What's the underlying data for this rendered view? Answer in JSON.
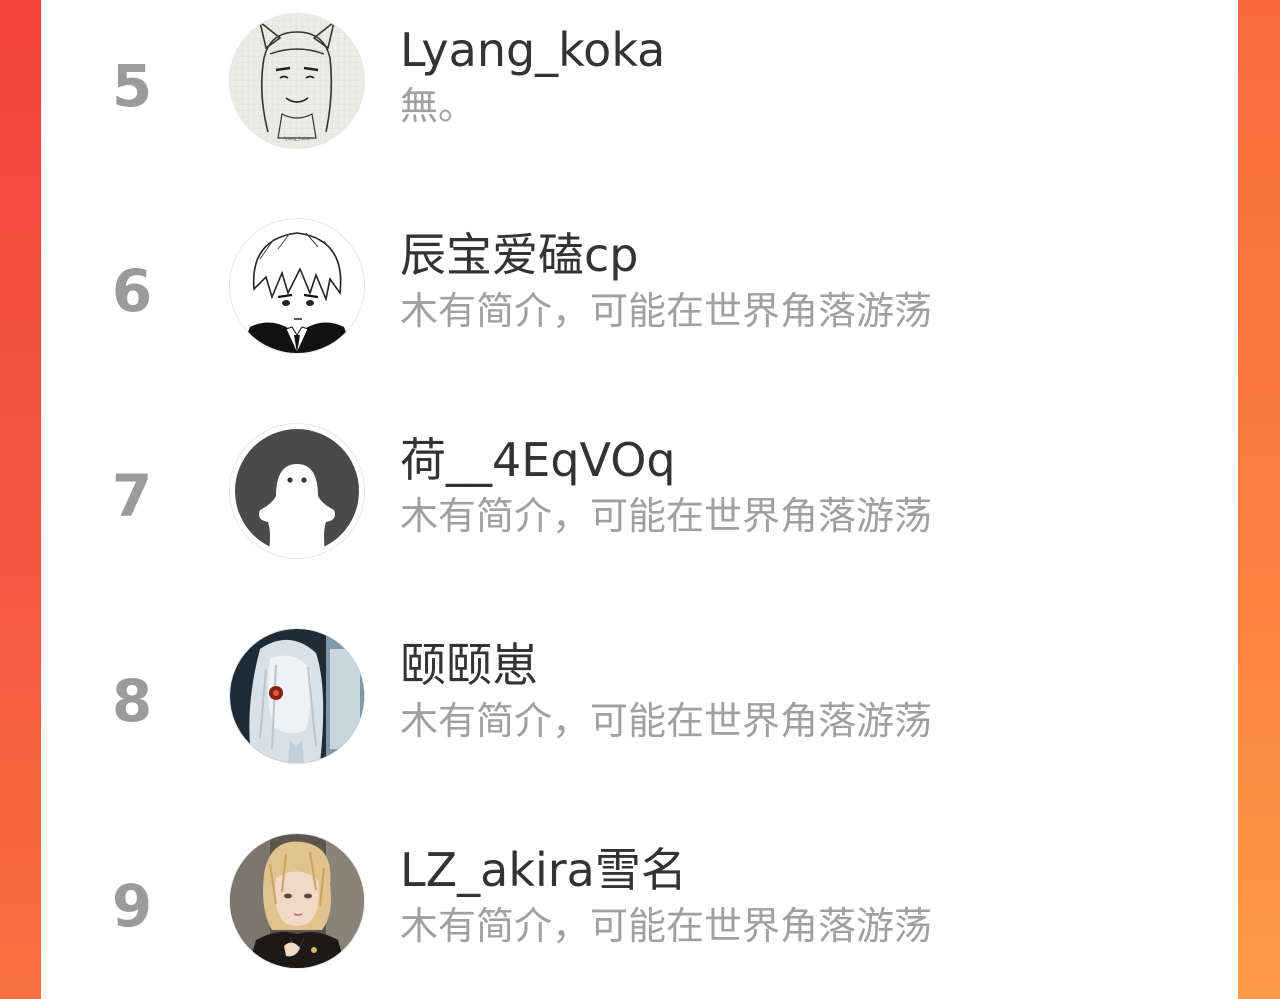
{
  "list": [
    {
      "rank": "5",
      "name": "Lyang_koka",
      "bio": "無。",
      "avatar_icon": "sketch-girl-avatar"
    },
    {
      "rank": "6",
      "name": "辰宝爱磕cp",
      "bio": "木有简介，可能在世界角落游荡",
      "avatar_icon": "manga-boy-avatar"
    },
    {
      "rank": "7",
      "name": "荷__4EqVOq",
      "bio": "木有简介，可能在世界角落游荡",
      "avatar_icon": "default-ghost-avatar"
    },
    {
      "rank": "8",
      "name": "颐颐崽",
      "bio": "木有简介，可能在世界角落游荡",
      "avatar_icon": "anime-silver-hair-avatar"
    },
    {
      "rank": "9",
      "name": "LZ_akira雪名",
      "bio": "木有简介，可能在世界角落游荡",
      "avatar_icon": "blonde-cosplay-avatar"
    }
  ],
  "colors": {
    "frame_left": "#f2453e",
    "frame_right": "#fb7d3f",
    "panel": "#ffffff",
    "rank": "#9b9b9b",
    "name": "#333333",
    "bio": "#a0a0a0"
  }
}
